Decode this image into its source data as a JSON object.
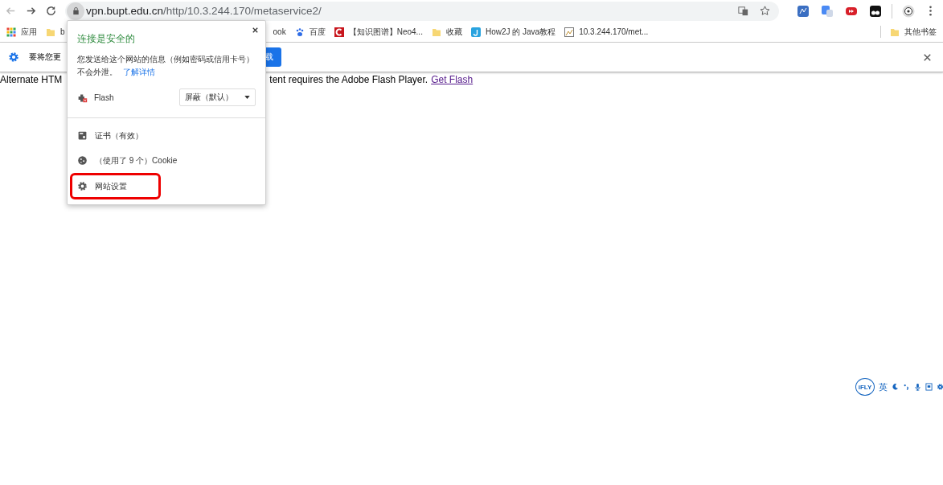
{
  "address_bar": {
    "domain": "vpn.bupt.edu.cn",
    "path": "/http/10.3.244.170/metaservice2/"
  },
  "bookmarks": [
    {
      "kind": "apps",
      "label": "应用"
    },
    {
      "kind": "folder",
      "label": "b"
    },
    {
      "kind": "plain",
      "label": "ook"
    },
    {
      "kind": "paw",
      "label": "百度"
    },
    {
      "kind": "red",
      "label": "【知识图谱】Neo4..."
    },
    {
      "kind": "folder",
      "label": "收藏"
    },
    {
      "kind": "blue",
      "label": "How2J 的 Java教程"
    },
    {
      "kind": "image",
      "label": "10.3.244.170/met..."
    }
  ],
  "other_bookmarks": "其他书签",
  "infobar": {
    "text": "要将您更",
    "button": "载"
  },
  "content": {
    "left": "Alternate HTM",
    "right": "tent requires the Adobe Flash Player.",
    "link": "Get Flash"
  },
  "site_info": {
    "title": "连接是安全的",
    "text": "您发送给这个网站的信息（例如密码或信用卡号）不会外泄。",
    "link": "了解详情",
    "permission": {
      "label": "Flash",
      "value": "屏蔽（默认）"
    },
    "items": [
      {
        "kind": "certificate",
        "label": "证书（有效）",
        "highlighted": false
      },
      {
        "kind": "cookie",
        "label": "（使用了 9 个）Cookie",
        "highlighted": false
      },
      {
        "kind": "settings",
        "label": "网站设置",
        "highlighted": true
      }
    ]
  },
  "ime_toolbar": {
    "logo": "iFLY",
    "language": "英"
  }
}
